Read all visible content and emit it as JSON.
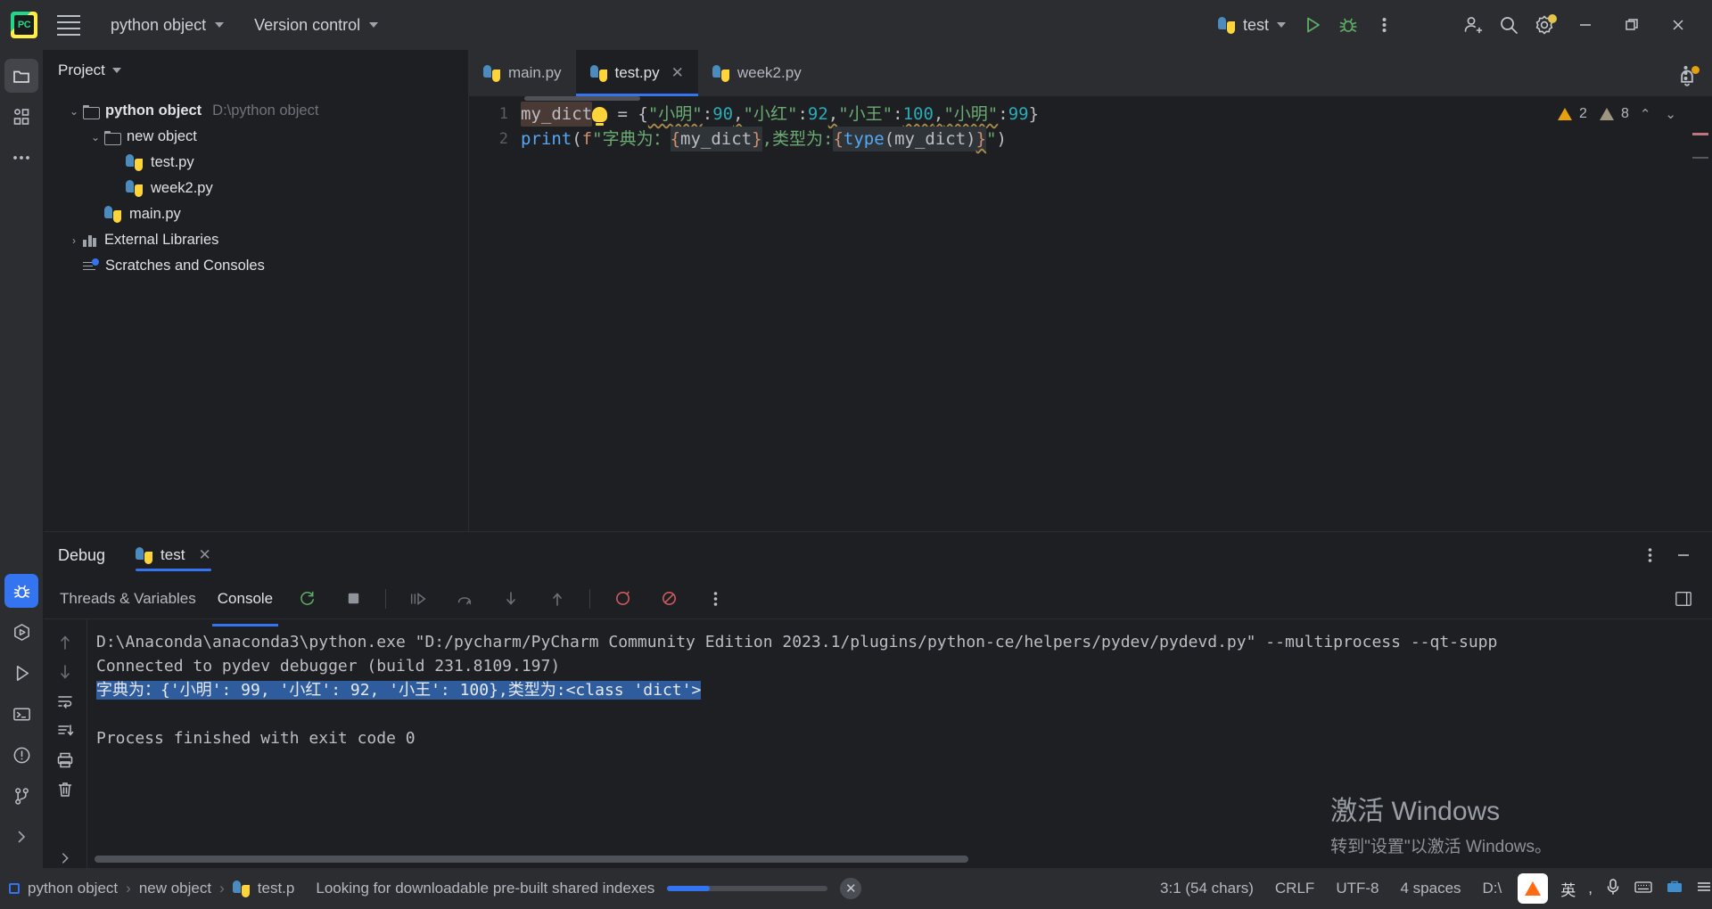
{
  "titlebar": {
    "logo_text": "PC",
    "menu_hamburger": "main-menu",
    "project_menu": "python object",
    "vcs_menu": "Version control",
    "run_config": "test",
    "icons": {
      "run": "run-icon",
      "debug": "debug-icon",
      "more": "more-actions-icon",
      "add_user": "add-user-icon",
      "search": "search-icon",
      "settings": "settings-gear-icon",
      "minimize": "minimize-icon",
      "maximize": "maximize-icon",
      "close": "close-icon"
    }
  },
  "rail": {
    "top": [
      {
        "name": "project-icon",
        "label": "Project"
      },
      {
        "name": "commit-icon",
        "label": "Structure"
      },
      {
        "name": "more-tool-windows-icon",
        "label": "More"
      }
    ],
    "bottom": [
      {
        "name": "debug-icon",
        "label": "Debug"
      },
      {
        "name": "run-anything-icon",
        "label": "Services"
      },
      {
        "name": "run-icon",
        "label": "Run"
      },
      {
        "name": "terminal-icon",
        "label": "Terminal"
      },
      {
        "name": "problems-icon",
        "label": "Problems"
      },
      {
        "name": "version-control-icon",
        "label": "Version Control"
      },
      {
        "name": "expand-icon",
        "label": "Expand"
      }
    ]
  },
  "project": {
    "title": "Project",
    "tree": [
      {
        "depth": 0,
        "arrow": "down",
        "icon": "folder-icon",
        "label": "python object",
        "path": "D:\\python object",
        "bold": true
      },
      {
        "depth": 1,
        "arrow": "down",
        "icon": "folder-icon",
        "label": "new object",
        "path": "",
        "bold": false
      },
      {
        "depth": 2,
        "arrow": "none",
        "icon": "python-file-icon",
        "label": "test.py",
        "path": "",
        "bold": false
      },
      {
        "depth": 2,
        "arrow": "none",
        "icon": "python-file-icon",
        "label": "week2.py",
        "path": "",
        "bold": false
      },
      {
        "depth": 1,
        "arrow": "none",
        "icon": "python-file-icon",
        "label": "main.py",
        "path": "",
        "bold": false
      },
      {
        "depth": 0,
        "arrow": "right",
        "icon": "library-icon",
        "label": "External Libraries",
        "path": "",
        "bold": false
      },
      {
        "depth": 0,
        "arrow": "none",
        "icon": "scratches-icon",
        "label": "Scratches and Consoles",
        "path": "",
        "bold": false
      }
    ]
  },
  "editor": {
    "tabs": [
      {
        "label": "main.py",
        "active": false,
        "closable": false
      },
      {
        "label": "test.py",
        "active": true,
        "closable": true
      },
      {
        "label": "week2.py",
        "active": false,
        "closable": false
      }
    ],
    "inspections": {
      "warning_count": "2",
      "weak_warning_count": "8"
    },
    "lines": [
      {
        "number": "1"
      },
      {
        "number": "2"
      }
    ],
    "line1": {
      "var": "my_dict",
      "eq": " = ",
      "open": "{",
      "pairs": [
        {
          "key": "\"小明\"",
          "colon": ":",
          "value": "90",
          "comma": ","
        },
        {
          "key": "\"小红\"",
          "colon": ":",
          "value": "92",
          "comma": ","
        },
        {
          "key": "\"小王\"",
          "colon": ":",
          "value": "100",
          "comma": ","
        },
        {
          "key": "\"小明\"",
          "colon": ":",
          "value": "99",
          "comma": ""
        }
      ],
      "close": "}"
    },
    "line2": {
      "fn": "print",
      "p_open": "(",
      "f_prefix": "f",
      "quote": "\"",
      "text1": "字典为：",
      "b1_open": "{",
      "b1_inner": "my_dict",
      "b1_close": "}",
      "text2": ",类型为:",
      "b2_open": "{",
      "b2_fn": "type",
      "b2_args": "(my_dict)",
      "b2_close": "}",
      "quote2": "\"",
      "p_close": ")"
    }
  },
  "debug": {
    "title": "Debug",
    "session_tab": "test",
    "sub_tabs": [
      {
        "label": "Threads & Variables",
        "active": false
      },
      {
        "label": "Console",
        "active": true
      }
    ],
    "toolbar_icons": [
      "rerun-icon",
      "stop-icon",
      "resume-icon",
      "step-over-icon",
      "step-into-icon",
      "step-out-icon",
      "mute-breakpoints-icon",
      "view-breakpoints-icon",
      "more-icon"
    ],
    "side_icons": [
      "scroll-up-icon",
      "scroll-down-icon",
      "soft-wrap-icon",
      "scroll-to-end-icon",
      "print-icon",
      "clear-all-icon",
      "expand-icon"
    ],
    "header_icons": [
      "options-icon",
      "hide-icon",
      "layout-settings-icon"
    ],
    "console": [
      {
        "text": "D:\\Anaconda\\anaconda3\\python.exe \"D:/pycharm/PyCharm Community Edition 2023.1/plugins/python-ce/helpers/pydev/pydevd.py\" --multiprocess --qt-supp",
        "selected": false
      },
      {
        "text": "Connected to pydev debugger (build 231.8109.197)",
        "selected": false
      },
      {
        "text": "字典为：{'小明': 99, '小红': 92, '小王': 100},类型为:<class 'dict'>",
        "selected": true
      },
      {
        "text": "",
        "selected": false
      },
      {
        "text": "Process finished with exit code 0",
        "selected": false
      }
    ]
  },
  "watermark": {
    "line1": "激活 Windows",
    "line2": "转到\"设置\"以激活 Windows。"
  },
  "statusbar": {
    "breadcrumbs": [
      "python object",
      "new object",
      "test.p"
    ],
    "message": "Looking for downloadable pre-built shared indexes",
    "caret": "3:1 (54 chars)",
    "line_sep": "CRLF",
    "encoding": "UTF-8",
    "indent": "4 spaces",
    "branch": "D:\\",
    "tray": {
      "ime": "英",
      "icons": [
        "comma-icon",
        "microphone-icon",
        "keyboard-icon",
        "toolbox-icon",
        "menu-icon"
      ]
    }
  },
  "colors": {
    "accent": "#3574f0",
    "bg": "#1e1f22",
    "panel": "#2b2d30",
    "warn": "#e5a00d",
    "string": "#6aab73",
    "number": "#2aacb8",
    "keyword": "#cf8e6d"
  }
}
